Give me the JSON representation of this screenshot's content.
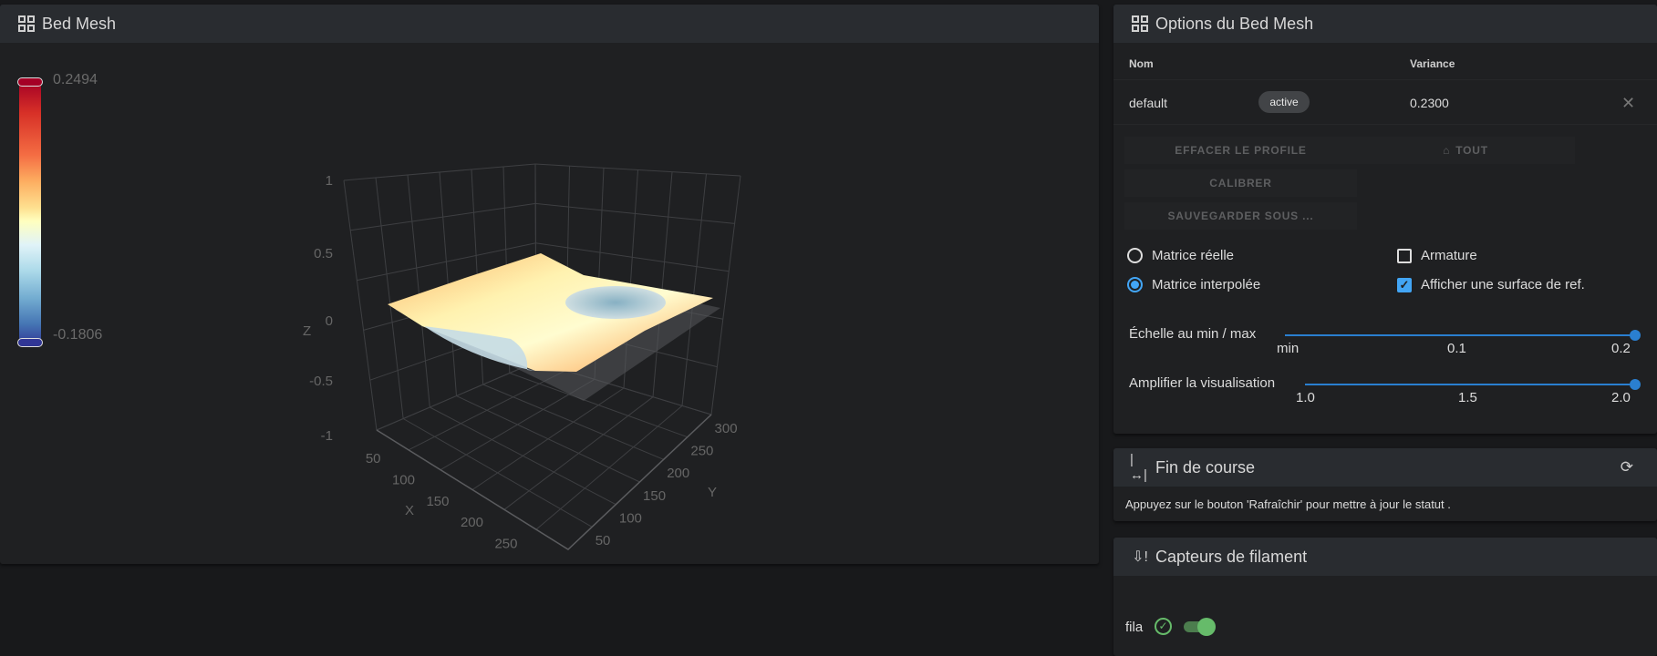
{
  "bed_mesh": {
    "title": "Bed Mesh",
    "icon": "grid-icon",
    "colorbar": {
      "max_label": "0.2494",
      "min_label": "-0.1806",
      "colors": [
        "#a50026",
        "#f46d43",
        "#fee090",
        "#ffffbf",
        "#e0f3f8",
        "#74add1",
        "#313695"
      ]
    }
  },
  "chart_data": {
    "type": "surface3d",
    "title": "",
    "xlabel": "X",
    "ylabel": "Y",
    "zlabel": "Z",
    "x_ticks": [
      "50",
      "100",
      "150",
      "200",
      "250"
    ],
    "y_ticks": [
      "50",
      "100",
      "150",
      "200",
      "250",
      "300"
    ],
    "z_ticks": [
      "1",
      "0.5",
      "0",
      "-0.5",
      "-1"
    ],
    "zlim": [
      -1,
      1
    ],
    "color_range": [
      -0.1806,
      0.2494
    ]
  },
  "options": {
    "title": "Options du Bed Mesh",
    "col_name": "Nom",
    "col_variance": "Variance",
    "profile": {
      "name": "default",
      "badge": "active",
      "variance": "0.2300"
    },
    "buttons": {
      "clear": "EFFACER LE PROFILE",
      "home": "TOUT",
      "calibrate": "CALIBRER",
      "save_as": "SAUVEGARDER SOUS ..."
    },
    "radio_real": "Matrice réelle",
    "radio_interp": "Matrice interpolée",
    "check_wireframe": "Armature",
    "check_ref": "Afficher une surface de ref.",
    "scale": {
      "label": "Échelle au min / max",
      "ticks": [
        "min",
        "0.1",
        "0.2"
      ],
      "value": 0.2
    },
    "amplify": {
      "label": "Amplifier la visualisation",
      "ticks": [
        "1.0",
        "1.5",
        "2.0"
      ],
      "value": 2.0
    },
    "accent": "#2a7fd0"
  },
  "endstops": {
    "title": "Fin de course",
    "message": "Appuyez sur le bouton 'Rafraîchir' pour mettre à jour le statut ."
  },
  "filament": {
    "title": "Capteurs de filament",
    "sensor_name": "fila",
    "enabled": true,
    "accent": "#66bb6a"
  }
}
